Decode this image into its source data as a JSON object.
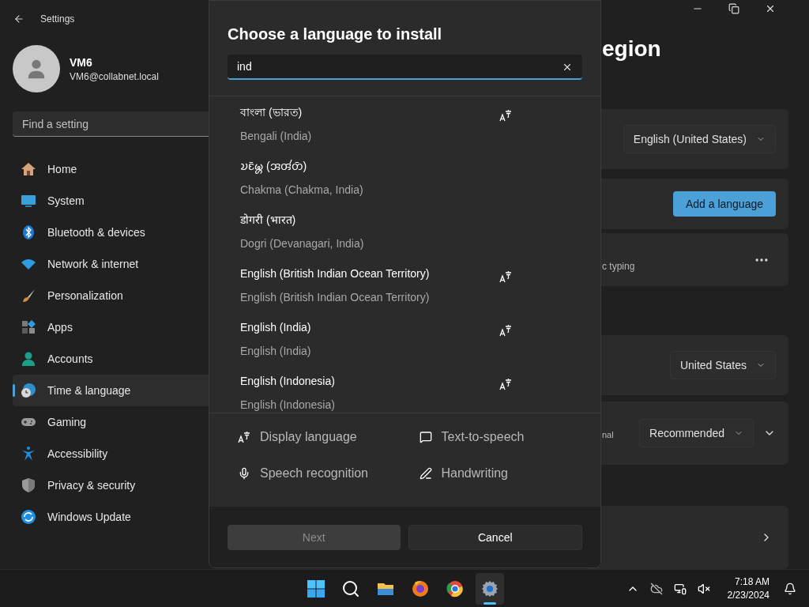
{
  "window": {
    "title": "Settings"
  },
  "user": {
    "name": "VM6",
    "email": "VM6@collabnet.local"
  },
  "sidebar": {
    "search": {
      "placeholder": "Find a setting"
    },
    "items": [
      {
        "label": "Home",
        "selected": false
      },
      {
        "label": "System",
        "selected": false
      },
      {
        "label": "Bluetooth & devices",
        "selected": false
      },
      {
        "label": "Network & internet",
        "selected": false
      },
      {
        "label": "Personalization",
        "selected": false
      },
      {
        "label": "Apps",
        "selected": false
      },
      {
        "label": "Accounts",
        "selected": false
      },
      {
        "label": "Time & language",
        "selected": true
      },
      {
        "label": "Gaming",
        "selected": false
      },
      {
        "label": "Accessibility",
        "selected": false
      },
      {
        "label": "Privacy & security",
        "selected": false
      },
      {
        "label": "Windows Update",
        "selected": false
      }
    ]
  },
  "page": {
    "title_fragment": "egion",
    "cards": [
      {
        "kind": "dropdown",
        "value": "English (United States)"
      },
      {
        "kind": "button",
        "label": "Add a language"
      },
      {
        "kind": "more",
        "fragment": "c typing"
      },
      {
        "kind": "dropdown",
        "value": "United States"
      },
      {
        "kind": "dropdown-expand",
        "fragment": "nal",
        "value": "Recommended"
      },
      {
        "kind": "link"
      }
    ]
  },
  "dialog": {
    "title": "Choose a language to install",
    "search": {
      "value": "ind"
    },
    "languages": [
      {
        "native": "বাংলা (ভারত)",
        "english": "Bengali (India)",
        "display_language": true
      },
      {
        "native": "𑄌𑄋𑄴𑄟𑄳𑄦 (𑄞𑄢𑄧𑄖𑄴)",
        "english": "Chakma (Chakma, India)",
        "display_language": false
      },
      {
        "native": "डोगरी (भारत)",
        "english": "Dogri (Devanagari, India)",
        "display_language": false
      },
      {
        "native": "English (British Indian Ocean Territory)",
        "english": "English (British Indian Ocean Territory)",
        "display_language": true
      },
      {
        "native": "English (India)",
        "english": "English (India)",
        "display_language": true
      },
      {
        "native": "English (Indonesia)",
        "english": "English (Indonesia)",
        "display_language": true
      }
    ],
    "features": [
      "Display language",
      "Text-to-speech",
      "Speech recognition",
      "Handwriting"
    ],
    "buttons": [
      {
        "label": "Next",
        "disabled": true
      },
      {
        "label": "Cancel",
        "disabled": false
      }
    ]
  },
  "taskbar": {
    "apps": [
      {
        "active": false
      },
      {
        "active": false
      },
      {
        "active": false
      },
      {
        "active": true
      }
    ],
    "time": "7:18 AM",
    "date": "2/23/2024"
  }
}
